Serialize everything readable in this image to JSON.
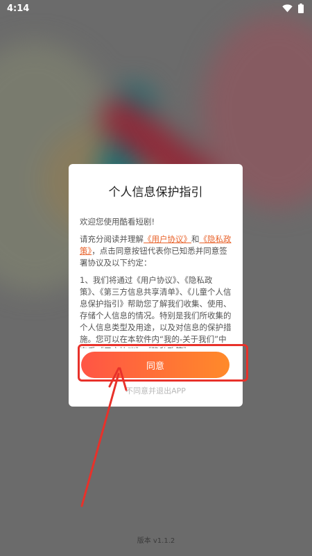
{
  "status_bar": {
    "time": "4:14"
  },
  "dialog": {
    "title": "个人信息保护指引",
    "welcome": "欢迎您使用酷看短剧!",
    "para1_prefix": "请充分阅读并理解",
    "user_agreement_link": "《用户协议》",
    "para1_and": "和",
    "privacy_policy_link": "《隐私政策》",
    "para1_suffix": "，点击同意按钮代表你已知悉并同意签署协议及以下约定：",
    "para2": "1、我们将通过《用户协议》、《隐私政策》、《第三方信息共享清单》、《儿童个人信息保护指引》帮助您了解我们收集、使用、存储个人信息的情况。特别是我们所收集的个人信息类型及用途，以及对信息的保护措施。您可以在本软件内“我的-关于我们”中查看《用户协议》、《隐私政策》",
    "agree_label": "同意",
    "disagree_label": "不同意并退出APP"
  },
  "footer": {
    "version": "版本 v1.1.2"
  },
  "colors": {
    "accent_start": "#ff5545",
    "accent_end": "#ff8a2a",
    "link": "#e8622a",
    "annotation": "#e8312a"
  }
}
